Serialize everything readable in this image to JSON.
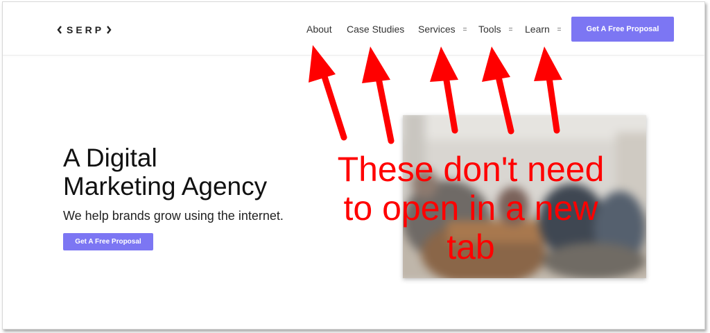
{
  "header": {
    "logo_text": "SERP",
    "nav": [
      {
        "label": "About",
        "has_dropdown": false
      },
      {
        "label": "Case Studies",
        "has_dropdown": false
      },
      {
        "label": "Services",
        "has_dropdown": true
      },
      {
        "label": "Tools",
        "has_dropdown": true
      },
      {
        "label": "Learn",
        "has_dropdown": true
      }
    ],
    "cta_label": "Get A Free Proposal"
  },
  "hero": {
    "title_line1": "A Digital",
    "title_line2": "Marketing Agency",
    "subtitle": "We help brands grow using the internet.",
    "cta_label": "Get A Free Proposal",
    "image_icon": "team-photo-blurred"
  },
  "annotation": {
    "line1": "These don't need",
    "line2": "to open in a new",
    "line3": "tab"
  },
  "colors": {
    "accent": "#7c76f3",
    "annotation": "#ff0000",
    "text": "#222222"
  }
}
